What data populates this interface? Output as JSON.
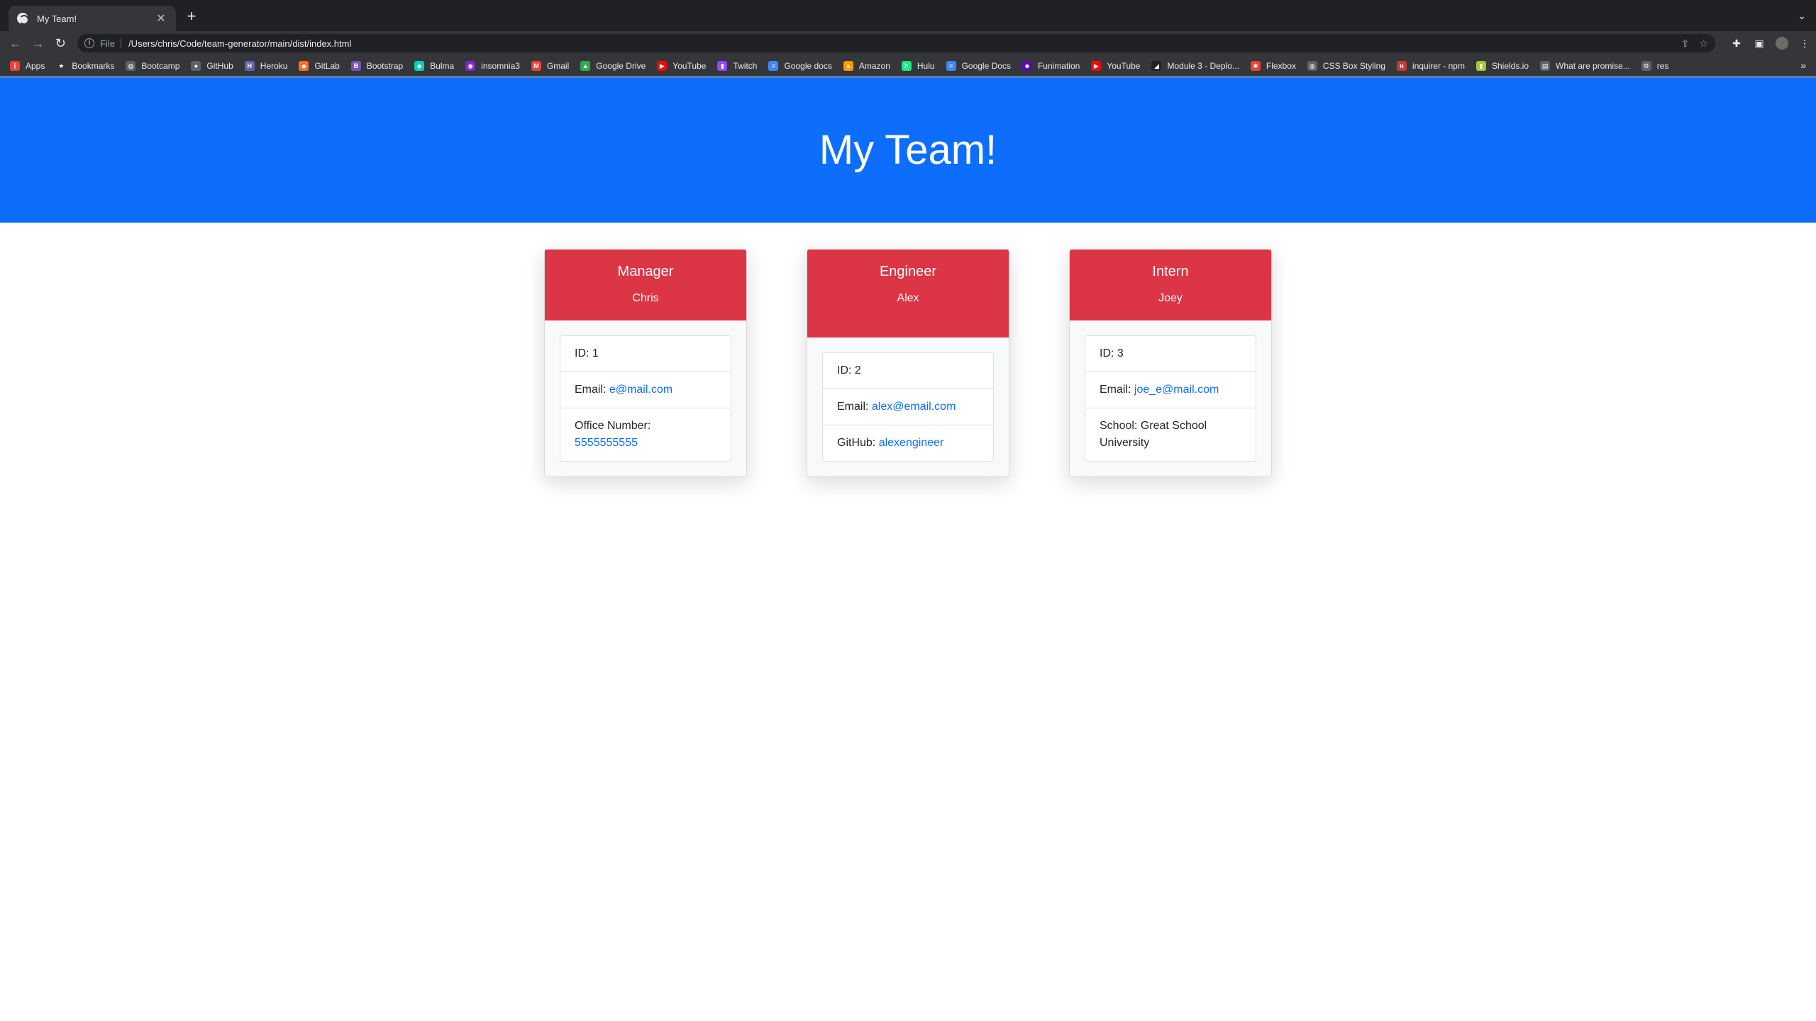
{
  "browser": {
    "tab_title": "My Team!",
    "tab_close": "✕",
    "new_tab": "+",
    "tab_menu": "⌄",
    "scheme": "File",
    "url": "/Users/chris/Code/team-generator/main/dist/index.html",
    "bookmarks": [
      {
        "label": "Apps",
        "icon": "apps-grid-icon",
        "color": "#ea4335",
        "glyph": "⋮"
      },
      {
        "label": "Bookmarks",
        "icon": "star-icon",
        "color": "#35363a",
        "glyph": "★"
      },
      {
        "label": "Bootcamp",
        "icon": "globe-icon",
        "color": "#5f6368",
        "glyph": "◍"
      },
      {
        "label": "GitHub",
        "icon": "github-icon",
        "color": "#5f6368",
        "glyph": "●"
      },
      {
        "label": "Heroku",
        "icon": "heroku-icon",
        "color": "#6762a6",
        "glyph": "H"
      },
      {
        "label": "GitLab",
        "icon": "gitlab-icon",
        "color": "#fc6d26",
        "glyph": "◆"
      },
      {
        "label": "Bootstrap",
        "icon": "bootstrap-icon",
        "color": "#7952b3",
        "glyph": "B"
      },
      {
        "label": "Bulma",
        "icon": "bulma-icon",
        "color": "#00d1b2",
        "glyph": "◆"
      },
      {
        "label": "insomnia3",
        "icon": "insomnia-icon",
        "color": "#7b2cbf",
        "glyph": "◉"
      },
      {
        "label": "Gmail",
        "icon": "gmail-icon",
        "color": "#ea4335",
        "glyph": "M"
      },
      {
        "label": "Google Drive",
        "icon": "google-drive-icon",
        "color": "#34a853",
        "glyph": "▲"
      },
      {
        "label": "YouTube",
        "icon": "youtube-icon",
        "color": "#ff0000",
        "glyph": "▶"
      },
      {
        "label": "Twitch",
        "icon": "twitch-icon",
        "color": "#9146ff",
        "glyph": "▮"
      },
      {
        "label": "Google docs",
        "icon": "google-docs-icon",
        "color": "#4285f4",
        "glyph": "≡"
      },
      {
        "label": "Amazon",
        "icon": "amazon-icon",
        "color": "#ff9900",
        "glyph": "a"
      },
      {
        "label": "Hulu",
        "icon": "hulu-icon",
        "color": "#1ce783",
        "glyph": "h"
      },
      {
        "label": "Google Docs",
        "icon": "google-docs-icon",
        "color": "#4285f4",
        "glyph": "≡"
      },
      {
        "label": "Funimation",
        "icon": "funimation-icon",
        "color": "#5b0bb5",
        "glyph": "☻"
      },
      {
        "label": "YouTube",
        "icon": "youtube-icon",
        "color": "#ff0000",
        "glyph": "▶"
      },
      {
        "label": "Module 3 - Deplo...",
        "icon": "module-icon",
        "color": "#202124",
        "glyph": "◢"
      },
      {
        "label": "Flexbox",
        "icon": "flexbox-icon",
        "color": "#ea4335",
        "glyph": "✱"
      },
      {
        "label": "CSS Box Styling",
        "icon": "globe-icon",
        "color": "#5f6368",
        "glyph": "◍"
      },
      {
        "label": "inquirer - npm",
        "icon": "npm-icon",
        "color": "#cb3837",
        "glyph": "n"
      },
      {
        "label": "Shields.io",
        "icon": "shields-icon",
        "color": "#a4c639",
        "glyph": "▮"
      },
      {
        "label": "What are promise...",
        "icon": "page-icon",
        "color": "#5f6368",
        "glyph": "▤"
      },
      {
        "label": "res",
        "icon": "res-icon",
        "color": "#5f6368",
        "glyph": "⚙"
      }
    ],
    "bookmarks_more": "»"
  },
  "page": {
    "title": "My Team!",
    "colors": {
      "header": "#0d6efd",
      "card_header": "#dc3545",
      "link": "#0d6efd"
    }
  },
  "cards": [
    {
      "role": "Manager",
      "name": "Chris",
      "rows": [
        {
          "label": "ID: ",
          "value": "1",
          "link": false
        },
        {
          "label": "Email: ",
          "value": "e@mail.com",
          "link": true
        },
        {
          "label": "Office Number: ",
          "value": "5555555555",
          "link": true
        }
      ]
    },
    {
      "role": "Engineer",
      "name": "Alex",
      "rows": [
        {
          "label": "ID: ",
          "value": "2",
          "link": false
        },
        {
          "label": "Email: ",
          "value": "alex@email.com",
          "link": true
        },
        {
          "label": "GitHub: ",
          "value": "alexengineer",
          "link": true
        }
      ]
    },
    {
      "role": "Intern",
      "name": "Joey",
      "rows": [
        {
          "label": "ID: ",
          "value": "3",
          "link": false
        },
        {
          "label": "Email: ",
          "value": "joe_e@mail.com",
          "link": true
        },
        {
          "label": "School: ",
          "value": "Great School University",
          "link": false
        }
      ]
    }
  ]
}
